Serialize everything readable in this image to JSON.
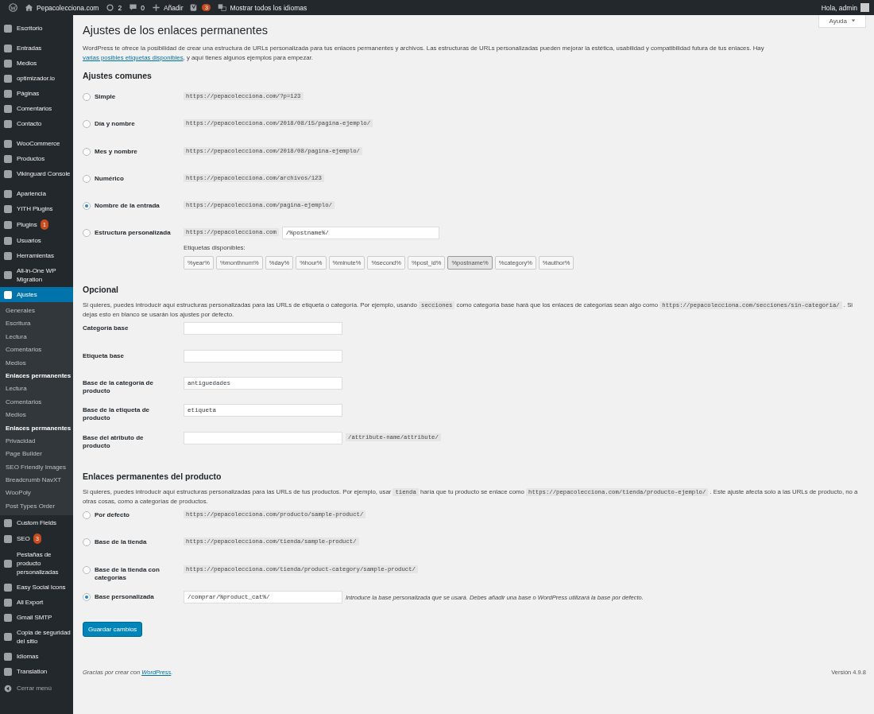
{
  "admin_bar": {
    "site": "Pepacolecciona.com",
    "updates": "2",
    "comments": "0",
    "new": "Añadir",
    "seo_badge": "3",
    "languages": "Mostrar todos los idiomas",
    "greeting": "Hola, admin"
  },
  "sidebar": {
    "groups": [
      [
        {
          "label": "Escritorio",
          "selected": false
        }
      ],
      [
        {
          "label": "Entradas",
          "selected": false
        },
        {
          "label": "Medios",
          "selected": false
        },
        {
          "label": "optimizador.io",
          "selected": false
        },
        {
          "label": "Páginas",
          "selected": false
        },
        {
          "label": "Comentarios",
          "selected": false
        },
        {
          "label": "Contacto",
          "selected": false
        }
      ],
      [
        {
          "label": "WooCommerce",
          "selected": false
        },
        {
          "label": "Productos",
          "selected": false
        },
        {
          "label": "Vikinguard Console",
          "selected": false
        }
      ],
      [
        {
          "label": "Apariencia",
          "selected": false
        },
        {
          "label": "YITH Plugins",
          "selected": false
        },
        {
          "label": "Plugins",
          "badge": "1",
          "selected": false
        },
        {
          "label": "Usuarios",
          "selected": false
        },
        {
          "label": "Herramientas",
          "selected": false
        },
        {
          "label": "All-in-One WP Migration",
          "selected": false
        },
        {
          "label": "Ajustes",
          "selected": true,
          "submenu": [
            {
              "label": "Generales",
              "selected": false
            },
            {
              "label": "Escritura",
              "selected": false
            },
            {
              "label": "Lectura",
              "selected": false
            },
            {
              "label": "Comentarios",
              "selected": false
            },
            {
              "label": "Medios",
              "selected": false
            },
            {
              "label": "Enlaces permanentes",
              "selected": true
            },
            {
              "label": "Lectura",
              "selected": false
            },
            {
              "label": "Comentarios",
              "selected": false
            },
            {
              "label": "Medios",
              "selected": false
            },
            {
              "label": "Enlaces permanentes",
              "selected": true
            },
            {
              "label": "Privacidad",
              "selected": false
            },
            {
              "label": "Page Builder",
              "selected": false
            },
            {
              "label": "SEO Friendly Images",
              "selected": false
            },
            {
              "label": "Breadcrumb NavXT",
              "selected": false
            },
            {
              "label": "WooPoly",
              "selected": false
            },
            {
              "label": "Post Types Order",
              "selected": false
            }
          ]
        },
        {
          "label": "Custom Fields",
          "selected": false
        },
        {
          "label": "SEO",
          "badge": "3",
          "selected": false
        },
        {
          "label": "Pestañas de producto personalizadas",
          "selected": false
        },
        {
          "label": "Easy Social Icons",
          "selected": false
        },
        {
          "label": "All Export",
          "selected": false
        },
        {
          "label": "Gmail SMTP",
          "selected": false
        },
        {
          "label": "Copia de seguridad del sitio",
          "selected": false
        },
        {
          "label": "Idiomas",
          "selected": false
        },
        {
          "label": "Translation",
          "selected": false
        }
      ]
    ],
    "collapse": "Cerrar menú"
  },
  "help_button": "Ayuda",
  "title": "Ajustes de los enlaces permanentes",
  "intro": [
    {
      "kind": "text",
      "text": "WordPress te ofrece la posibilidad de crear una estructura de URLs personalizada para tus enlaces permanentes y archivos. Las estructuras de URLs personalizadas pueden mejorar la estética, usabilidad y compatibilidad futura de tus enlaces. Hay "
    },
    {
      "kind": "link",
      "text": "varias posibles etiquetas disponibles"
    },
    {
      "kind": "text",
      "text": ", y aquí tienes algunos ejemplos para empezar."
    }
  ],
  "common": {
    "heading": "Ajustes comunes",
    "options": [
      {
        "label": "Simple",
        "example": "https://pepacolecciona.com/?p=123",
        "selected": false
      },
      {
        "label": "Día y nombre",
        "example": "https://pepacolecciona.com/2018/08/15/pagina-ejemplo/",
        "selected": false
      },
      {
        "label": "Mes y nombre",
        "example": "https://pepacolecciona.com/2018/08/pagina-ejemplo/",
        "selected": false
      },
      {
        "label": "Numérico",
        "example": "https://pepacolecciona.com/archivos/123",
        "selected": false
      },
      {
        "label": "Nombre de la entrada",
        "example": "https://pepacolecciona.com/pagina-ejemplo/",
        "selected": true
      },
      {
        "label": "Estructura personalizada",
        "example": "https://pepacolecciona.com",
        "value": "/%postname%/",
        "selected": false
      }
    ],
    "tags_label": "Etiquetas disponibles:",
    "tags": [
      {
        "label": "%year%",
        "selected": false
      },
      {
        "label": "%monthnum%",
        "selected": false
      },
      {
        "label": "%day%",
        "selected": false
      },
      {
        "label": "%hour%",
        "selected": false
      },
      {
        "label": "%minute%",
        "selected": false
      },
      {
        "label": "%second%",
        "selected": false
      },
      {
        "label": "%post_id%",
        "selected": false
      },
      {
        "label": "%postname%",
        "selected": true
      },
      {
        "label": "%category%",
        "selected": false
      },
      {
        "label": "%author%",
        "selected": false
      }
    ]
  },
  "optional": {
    "heading": "Opcional",
    "description": [
      {
        "kind": "text",
        "text": "Si quieres, puedes introducir aquí estructuras personalizadas para las URLs de etiqueta o categoría. Por ejemplo, usando "
      },
      {
        "kind": "code",
        "text": "secciones"
      },
      {
        "kind": "text",
        "text": " como categoría base hará que los enlaces de categorías sean algo como "
      },
      {
        "kind": "code",
        "text": "https://pepacolecciona.com/secciones/sin-categoria/"
      },
      {
        "kind": "text",
        "text": " . Si dejas esto en blanco se usarán los ajustes por defecto."
      }
    ],
    "fields": [
      {
        "label": "Categoría base"
      },
      {
        "label": "Etiqueta base"
      },
      {
        "label": "Base de la categoría de producto",
        "value": "antiguedades"
      },
      {
        "label": "Base de la etiqueta de producto",
        "value": "etiqueta"
      },
      {
        "label": "Base del atributo de producto",
        "suffix": "/attribute-name/attribute/"
      }
    ]
  },
  "product": {
    "heading": "Enlaces permanentes del producto",
    "description": [
      {
        "kind": "text",
        "text": "Si quieres, puedes introducir aquí estructuras personalizadas para las URLs de tus productos. Por ejemplo, usar "
      },
      {
        "kind": "code",
        "text": "tienda"
      },
      {
        "kind": "text",
        "text": " haría que tu producto se enlace como "
      },
      {
        "kind": "code",
        "text": "https://pepacolecciona.com/tienda/producto-ejemplo/"
      },
      {
        "kind": "text",
        "text": " . Este ajuste afecta solo a las URLs de producto, no a otras cosas, como a categorías de productos."
      }
    ],
    "options": [
      {
        "label": "Por defecto",
        "example": "https://pepacolecciona.com/producto/sample-product/",
        "selected": false
      },
      {
        "label": "Base de la tienda",
        "example": "https://pepacolecciona.com/tienda/sample-product/",
        "selected": false
      },
      {
        "label": "Base de la tienda con categorías",
        "example": "https://pepacolecciona.com/tienda/product-category/sample-product/",
        "selected": false
      },
      {
        "label": "Base personalizada",
        "value": "/comprar/%product_cat%/",
        "hint": "Introduce la base personalizada que se usará. Debes añadir una base o WordPress utilizará la base por defecto.",
        "selected": true
      }
    ]
  },
  "save_button": "Guardar cambios",
  "footer": {
    "text": "Gracias por crear con ",
    "link": "WordPress",
    "suffix": ".",
    "version": "Versión 4.9.8"
  }
}
